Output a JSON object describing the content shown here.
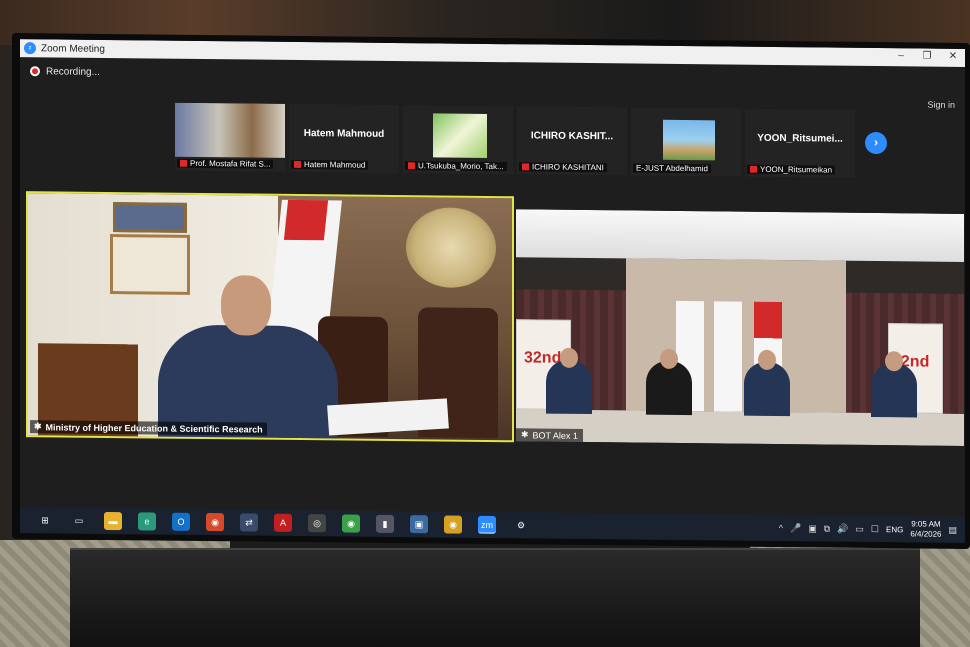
{
  "window": {
    "title": "Zoom Meeting",
    "controls": [
      "–",
      "❐",
      "✕"
    ]
  },
  "meeting": {
    "recording_label": "Recording...",
    "sign_in_label": "Sign in"
  },
  "participants": [
    {
      "display": "photo",
      "label": "Prof. Mostafa Rifat S..."
    },
    {
      "display": "name",
      "big_name": "Hatem Mahmoud",
      "label": "Hatem Mahmoud"
    },
    {
      "display": "avatar",
      "label": "U.Tsukuba_Morio, Tak..."
    },
    {
      "display": "name",
      "big_name": "ICHIRO KASHIT...",
      "label": "ICHIRO KASHITANI"
    },
    {
      "display": "campus",
      "label": "E-JUST Abdelhamid"
    },
    {
      "display": "name",
      "big_name": "YOON_Ritsumei...",
      "label": "YOON_Ritsumeikan"
    }
  ],
  "next_page_icon": "›",
  "main_video": {
    "label": "Ministry of Higher Education & Scientific Research"
  },
  "second_video": {
    "label": "BOT Alex 1",
    "banner_text": "32nd"
  },
  "taskbar": {
    "icons": [
      {
        "name": "windows-start-icon",
        "glyph": "⊞",
        "color": "#1a2230"
      },
      {
        "name": "task-view-icon",
        "glyph": "▭",
        "color": "#1a2230"
      },
      {
        "name": "file-explorer-icon",
        "glyph": "▬",
        "color": "#e8b230"
      },
      {
        "name": "edge-icon",
        "glyph": "e",
        "color": "#2a9a7a"
      },
      {
        "name": "outlook-icon",
        "glyph": "O",
        "color": "#1570c8"
      },
      {
        "name": "chrome-icon",
        "glyph": "◉",
        "color": "#d64a2a"
      },
      {
        "name": "network-app-icon",
        "glyph": "⇄",
        "color": "#3a4a6a"
      },
      {
        "name": "pdf-icon",
        "glyph": "A",
        "color": "#c02020"
      },
      {
        "name": "obs-icon",
        "glyph": "◎",
        "color": "#444"
      },
      {
        "name": "chrome-2-icon",
        "glyph": "◉",
        "color": "#3aa04a"
      },
      {
        "name": "usb-app-icon",
        "glyph": "▮",
        "color": "#556"
      },
      {
        "name": "camera-app-icon",
        "glyph": "▣",
        "color": "#3a6aa0"
      },
      {
        "name": "chrome-3-icon",
        "glyph": "◉",
        "color": "#d6a020"
      },
      {
        "name": "zoom-app-icon",
        "glyph": "zm",
        "color": "#2d8cff"
      },
      {
        "name": "settings-icon",
        "glyph": "⚙",
        "color": "#1a2230"
      }
    ],
    "tray": {
      "icons": [
        "^",
        "🎤",
        "▣",
        "⧉",
        "🔊",
        "▭",
        "☐"
      ],
      "language": "ENG",
      "time": "9:05 AM",
      "date": "6/4/2026",
      "notification_icon": "▤"
    }
  }
}
